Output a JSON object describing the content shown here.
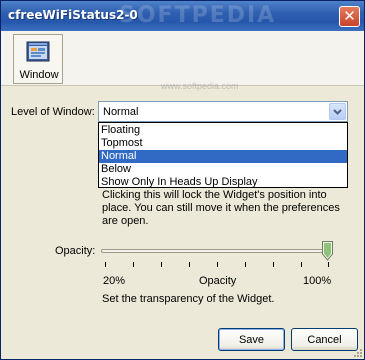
{
  "window": {
    "title": "cfreeWiFiStatus2-0",
    "watermark": "SOFTPEDIA",
    "watermark_url": "www.softpedia.com"
  },
  "toolbar": {
    "window_label": "Window",
    "window_icon": "window-settings-icon"
  },
  "level": {
    "label": "Level of Window:",
    "selected": "Normal",
    "options": [
      "Floating",
      "Topmost",
      "Normal",
      "Below",
      "Show Only In Heads Up Display"
    ],
    "selected_index": 2
  },
  "description": "Clicking this will lock the Widget's position into place. You can still move it when the preferences are open.",
  "opacity": {
    "label": "Opacity:",
    "value_fraction": 1.0,
    "min_label": "20%",
    "mid_label": "Opacity",
    "max_label": "100%",
    "hint": "Set the transparency of the Widget."
  },
  "buttons": {
    "save": "Save",
    "cancel": "Cancel"
  },
  "colors": {
    "title_bar": "#2557ac",
    "selection": "#316ac5",
    "face": "#ece9d8"
  }
}
